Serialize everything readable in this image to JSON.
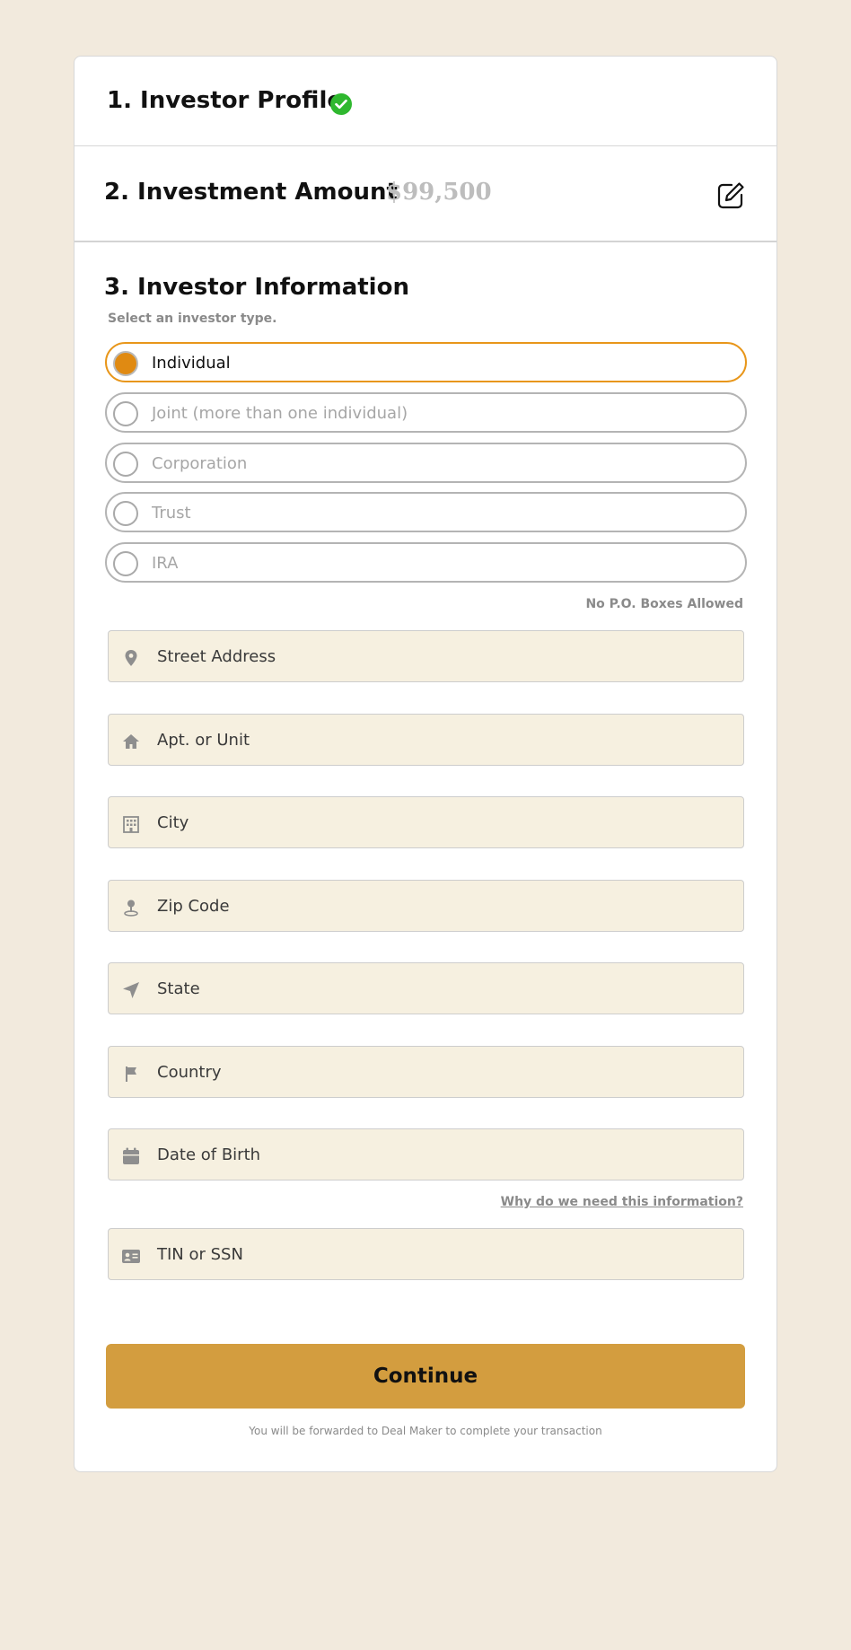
{
  "steps": {
    "profile": {
      "title": "1. Investor Profile",
      "status_icon": "check-circle-icon",
      "status_color": "#2fb82f"
    },
    "amount": {
      "title": "2. Investment Amount",
      "value": "$99,500",
      "edit_icon": "edit-icon"
    },
    "info": {
      "title": "3. Investor Information",
      "subtitle": "Select an investor type."
    }
  },
  "investor_types": [
    {
      "label": "Individual",
      "selected": true
    },
    {
      "label": "Joint (more than one individual)",
      "selected": false
    },
    {
      "label": "Corporation",
      "selected": false
    },
    {
      "label": "Trust",
      "selected": false
    },
    {
      "label": "IRA",
      "selected": false
    }
  ],
  "address_note": "No P.O. Boxes Allowed",
  "fields": {
    "street": {
      "placeholder": "Street Address",
      "icon": "map-pin-icon"
    },
    "apt": {
      "placeholder": "Apt. or Unit",
      "icon": "home-icon"
    },
    "city": {
      "placeholder": "City",
      "icon": "building-icon"
    },
    "zip": {
      "placeholder": "Zip Code",
      "icon": "location-marker-icon"
    },
    "state": {
      "placeholder": "State",
      "icon": "navigation-arrow-icon"
    },
    "country": {
      "placeholder": "Country",
      "icon": "flag-icon"
    },
    "dob": {
      "placeholder": "Date of Birth",
      "icon": "calendar-icon"
    },
    "tin": {
      "placeholder": "TIN or SSN",
      "icon": "id-card-icon"
    }
  },
  "why_link": "Why do we need this information?",
  "continue_label": "Continue",
  "forward_note": "You will be forwarded to Deal Maker to complete your transaction",
  "colors": {
    "accent": "#e08a12",
    "button": "#d39d3f",
    "field_bg": "#f6f0e0",
    "page_bg": "#f2eadd"
  }
}
